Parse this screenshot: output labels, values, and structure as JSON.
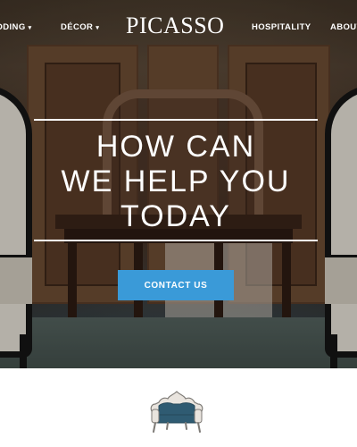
{
  "nav": {
    "items_left": [
      {
        "label": "DDING",
        "has_caret": true
      },
      {
        "label": "DÉCOR",
        "has_caret": true
      }
    ],
    "logo": "PICASSO",
    "items_right": [
      {
        "label": "HOSPITALITY",
        "has_caret": false
      },
      {
        "label": "ABOUT",
        "has_caret": false
      }
    ],
    "caret_glyph": "▾"
  },
  "hero": {
    "headline_lines": [
      "HOW CAN",
      "WE HELP YOU",
      "TODAY"
    ],
    "cta_label": "CONTACT US"
  },
  "colors": {
    "cta": "#3a9ad8",
    "text_on_hero": "#ffffff",
    "page_background": "#ffffff"
  },
  "icons": {
    "sofa": "ornate-sofa-icon",
    "dropdown": "caret-down-icon"
  }
}
